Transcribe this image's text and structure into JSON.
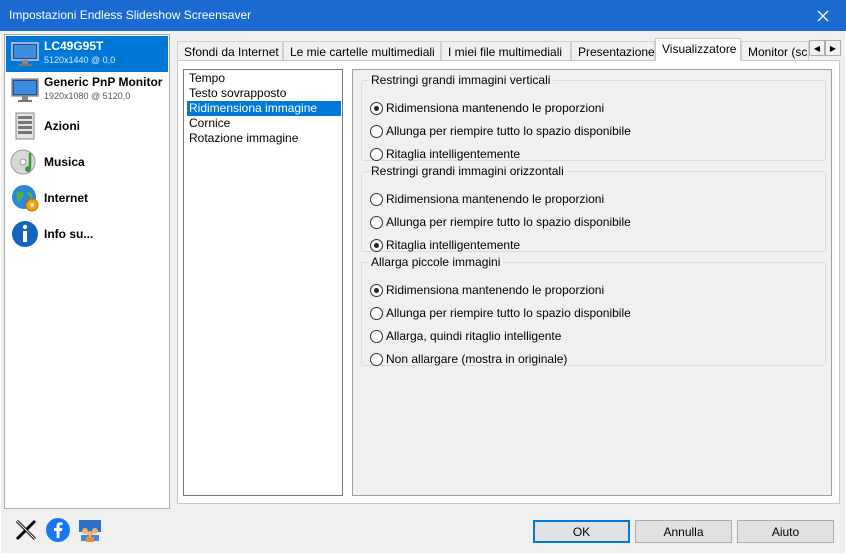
{
  "window": {
    "title": "Impostazioni Endless Slideshow Screensaver"
  },
  "sidebar": {
    "items": [
      {
        "label": "LC49G95T",
        "sub": "5120x1440 @ 0,0",
        "icon": "monitor-icon",
        "selected": true
      },
      {
        "label": "Generic PnP Monitor",
        "sub": "1920x1080 @ 5120,0",
        "icon": "monitor-icon",
        "selected": false
      },
      {
        "label": "Azioni",
        "icon": "actions-icon",
        "selected": false
      },
      {
        "label": "Musica",
        "icon": "music-icon",
        "selected": false
      },
      {
        "label": "Internet",
        "icon": "internet-icon",
        "selected": false
      },
      {
        "label": "Info su...",
        "icon": "info-icon",
        "selected": false
      }
    ]
  },
  "tabs": [
    {
      "label": "Sfondi da Internet"
    },
    {
      "label": "Le mie cartelle multimediali"
    },
    {
      "label": "I miei file multimediali"
    },
    {
      "label": "Presentazione"
    },
    {
      "label": "Visualizzatore",
      "active": true
    },
    {
      "label": "Monitor (sc"
    }
  ],
  "categories": [
    {
      "label": "Tempo"
    },
    {
      "label": "Testo sovrapposto"
    },
    {
      "label": "Ridimensiona immagine",
      "selected": true
    },
    {
      "label": "Cornice"
    },
    {
      "label": "Rotazione immagine"
    }
  ],
  "groups": [
    {
      "title": "Restringi grandi immagini verticali",
      "options": [
        {
          "label": "Ridimensiona mantenendo le proporzioni",
          "checked": true
        },
        {
          "label": "Allunga per riempire tutto lo spazio disponibile",
          "checked": false
        },
        {
          "label": "Ritaglia intelligentemente",
          "checked": false
        }
      ]
    },
    {
      "title": "Restringi grandi immagini orizzontali",
      "options": [
        {
          "label": "Ridimensiona mantenendo le proporzioni",
          "checked": false
        },
        {
          "label": "Allunga per riempire tutto lo spazio disponibile",
          "checked": false
        },
        {
          "label": "Ritaglia intelligentemente",
          "checked": true
        }
      ]
    },
    {
      "title": "Allarga piccole immagini",
      "options": [
        {
          "label": "Ridimensiona mantenendo le proporzioni",
          "checked": true
        },
        {
          "label": "Allunga per riempire tutto lo spazio disponibile",
          "checked": false
        },
        {
          "label": "Allarga, quindi ritaglio intelligente",
          "checked": false
        },
        {
          "label": "Non allargare (mostra in originale)",
          "checked": false
        }
      ]
    }
  ],
  "social": [
    {
      "icon": "x-twitter-icon"
    },
    {
      "icon": "facebook-icon"
    },
    {
      "icon": "community-icon"
    }
  ],
  "buttons": {
    "ok": "OK",
    "cancel": "Annulla",
    "help": "Aiuto"
  },
  "colors": {
    "titlebar": "#1a6ad2",
    "accent": "#0078d7"
  }
}
